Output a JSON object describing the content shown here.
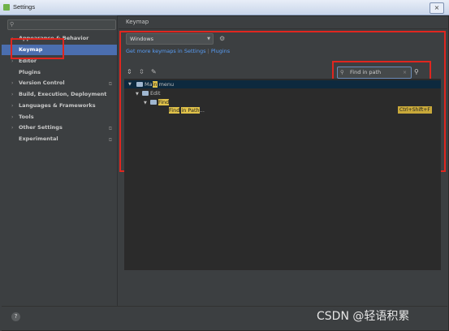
{
  "window": {
    "title": "Settings",
    "close_label": "×"
  },
  "sidebar": {
    "search_icon": "search-icon",
    "items": [
      {
        "label": "Appearance & Behavior",
        "arrow": "›"
      },
      {
        "label": "Keymap",
        "arrow": ""
      },
      {
        "label": "Editor",
        "arrow": "›"
      },
      {
        "label": "Plugins",
        "arrow": ""
      },
      {
        "label": "Version Control",
        "arrow": "›"
      },
      {
        "label": "Build, Execution, Deployment",
        "arrow": "›"
      },
      {
        "label": "Languages & Frameworks",
        "arrow": "›"
      },
      {
        "label": "Tools",
        "arrow": "›"
      },
      {
        "label": "Other Settings",
        "arrow": "›"
      },
      {
        "label": "Experimental",
        "arrow": ""
      }
    ]
  },
  "main": {
    "heading": "Keymap",
    "keymap_select": "Windows",
    "link_keymaps": "Get more keymaps in Settings",
    "link_sep": "|",
    "link_plugins": "Plugins",
    "find_placeholder": "Find in path",
    "tree": {
      "root_pre": "Ma",
      "root_hl": "in",
      "root_post": " menu",
      "edit": "Edit",
      "find_folder_hl": "Find",
      "action_hl1": "Find",
      "action_mid": " ",
      "action_hl2": "in Path",
      "action_post": "...",
      "shortcut": "Ctrl+Shift+F"
    }
  },
  "footer": {
    "help": "?",
    "watermark": "CSDN @轻语积累"
  },
  "colors": {
    "accent": "#4b6eaf",
    "highlight": "#e0c24a",
    "annotation_red": "#e0261f"
  }
}
